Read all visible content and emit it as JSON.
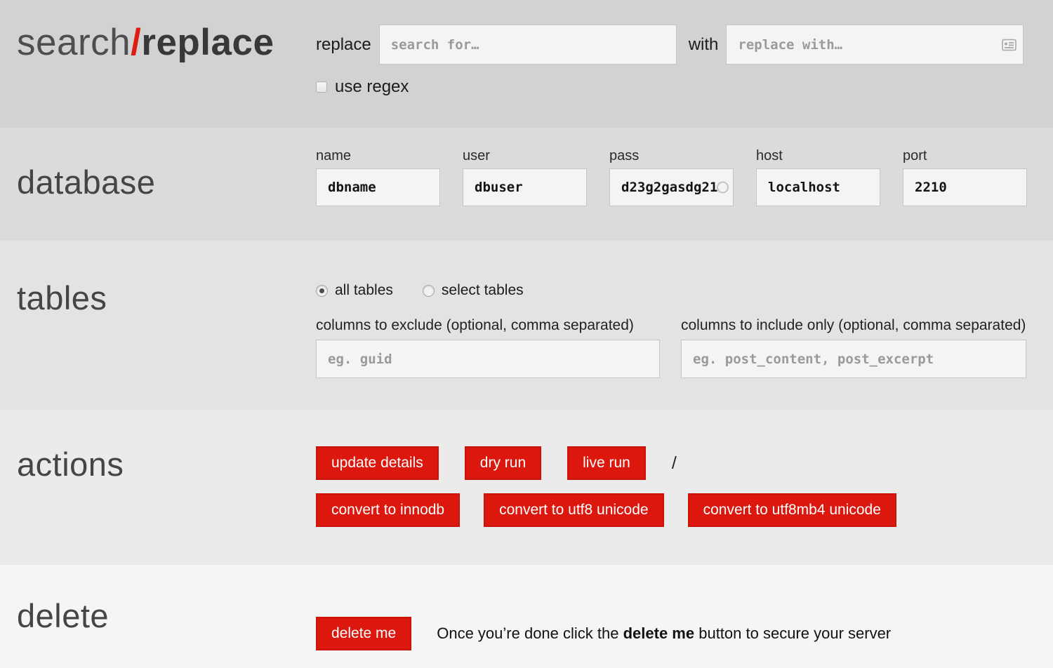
{
  "header": {
    "logo_light": "search",
    "logo_slash": "/",
    "logo_bold": "replace",
    "replace_label": "replace",
    "search_placeholder": "search for…",
    "with_label": "with",
    "replace_placeholder": "replace with…",
    "use_regex_label": "use regex"
  },
  "database": {
    "heading": "database",
    "fields": [
      {
        "label": "name",
        "value": "dbname"
      },
      {
        "label": "user",
        "value": "dbuser"
      },
      {
        "label": "pass",
        "value": "d23g2gasdg21"
      },
      {
        "label": "host",
        "value": "localhost"
      },
      {
        "label": "port",
        "value": "2210"
      }
    ]
  },
  "tables": {
    "heading": "tables",
    "all_tables_label": "all tables",
    "select_tables_label": "select tables",
    "exclude_label": "columns to exclude (optional, comma separated)",
    "exclude_placeholder": "eg. guid",
    "include_label": "columns to include only (optional, comma separated)",
    "include_placeholder": "eg. post_content, post_excerpt"
  },
  "actions": {
    "heading": "actions",
    "update_details": "update details",
    "dry_run": "dry run",
    "live_run": "live run",
    "separator": "/",
    "convert_innodb": "convert to innodb",
    "convert_utf8": "convert to utf8 unicode",
    "convert_utf8mb4": "convert to utf8mb4 unicode"
  },
  "delete": {
    "heading": "delete",
    "button_label": "delete me",
    "note_prefix": "Once you’re done click the ",
    "note_bold": "delete me",
    "note_suffix": " button to secure your server"
  },
  "colors": {
    "accent_red": "#dc170e",
    "logo_slash_red": "#e01b10"
  }
}
